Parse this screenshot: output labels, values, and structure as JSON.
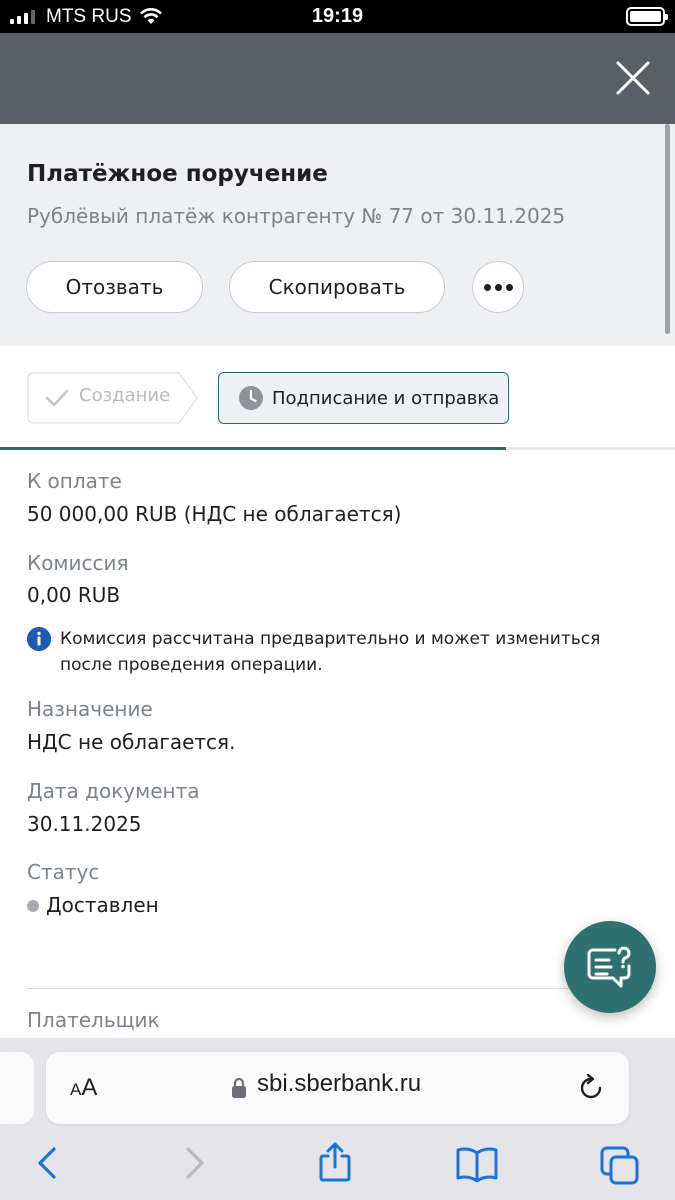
{
  "status_bar": {
    "carrier": "MTS RUS",
    "time": "19:19"
  },
  "header": {
    "title": "Платёжное поручение",
    "subtitle": "Рублёвый платёж контрагенту № 77 от 30.11.2025",
    "revoke_label": "Отозвать",
    "copy_label": "Скопировать"
  },
  "steps": [
    {
      "label": "Создание",
      "state": "done"
    },
    {
      "label": "Подписание и отправка",
      "state": "active"
    }
  ],
  "progress": {
    "fraction": 0.75
  },
  "details": {
    "to_pay_label": "К оплате",
    "to_pay_value": "50 000,00 RUB (НДС не облагается)",
    "commission_label": "Комиссия",
    "commission_value": "0,00 RUB",
    "commission_note": "Комиссия рассчитана предварительно и может измениться после проведения операции.",
    "purpose_label": "Назначение",
    "purpose_value": "НДС не облагается.",
    "date_label": "Дата документа",
    "date_value": "30.11.2025",
    "status_label": "Статус",
    "status_value": "Доставлен",
    "payer_label": "Плательщик"
  },
  "browser": {
    "aa_small": "A",
    "aa_big": "A",
    "url": "sbi.sberbank.ru"
  },
  "colors": {
    "accent": "#2b6b6a",
    "info": "#1d5bb4",
    "modal_overlay": "#5a5f67"
  }
}
